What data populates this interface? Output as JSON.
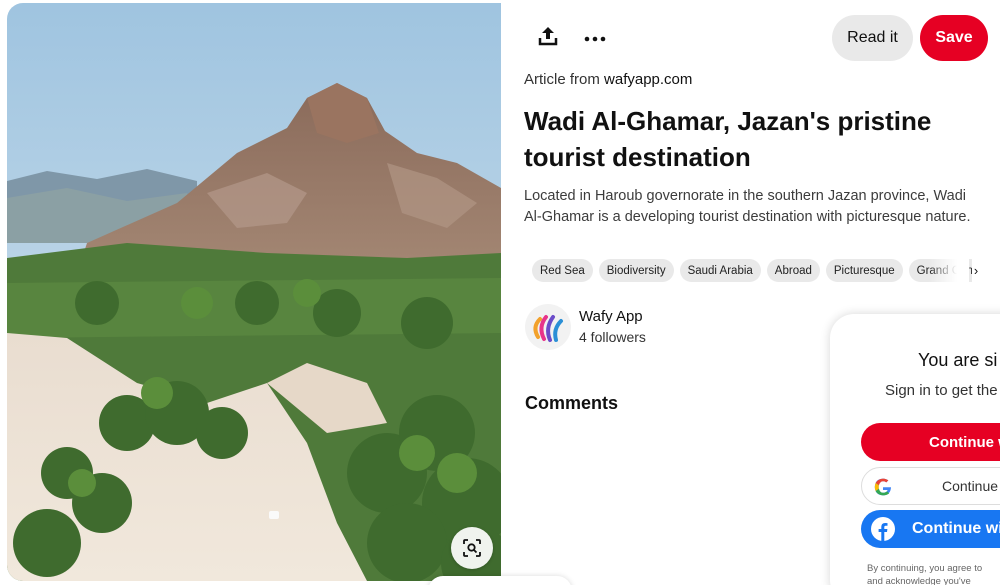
{
  "toolbar": {
    "share_icon": "share-upload-icon",
    "more_icon": "ellipsis-icon",
    "read_label": "Read it",
    "save_label": "Save",
    "accent": "#e60023"
  },
  "article": {
    "source_prefix": "Article from",
    "source_domain": "wafyapp.com",
    "title": "Wadi Al-Ghamar, Jazan's pristine tourist destination",
    "description": "Located in Haroub governorate in the southern Jazan province, Wadi Al-Ghamar is a developing tourist destination with picturesque nature."
  },
  "tags": [
    "Red Sea",
    "Biodiversity",
    "Saudi Arabia",
    "Abroad",
    "Picturesque",
    "Grand Canyon"
  ],
  "author": {
    "name": "Wafy App",
    "followers": "4 followers"
  },
  "comments": {
    "heading": "Comments"
  },
  "signin": {
    "title": "You are si",
    "subtitle": "Sign in to get the",
    "email_label": "Continue w",
    "google_label": "Continue",
    "facebook_label": "Continue wi",
    "fine_print_1": "By continuing, you agree to",
    "fine_print_2": "and acknowledge you've",
    "facebook_color": "#1877f2"
  },
  "image": {
    "lens_icon": "visual-search-icon"
  }
}
